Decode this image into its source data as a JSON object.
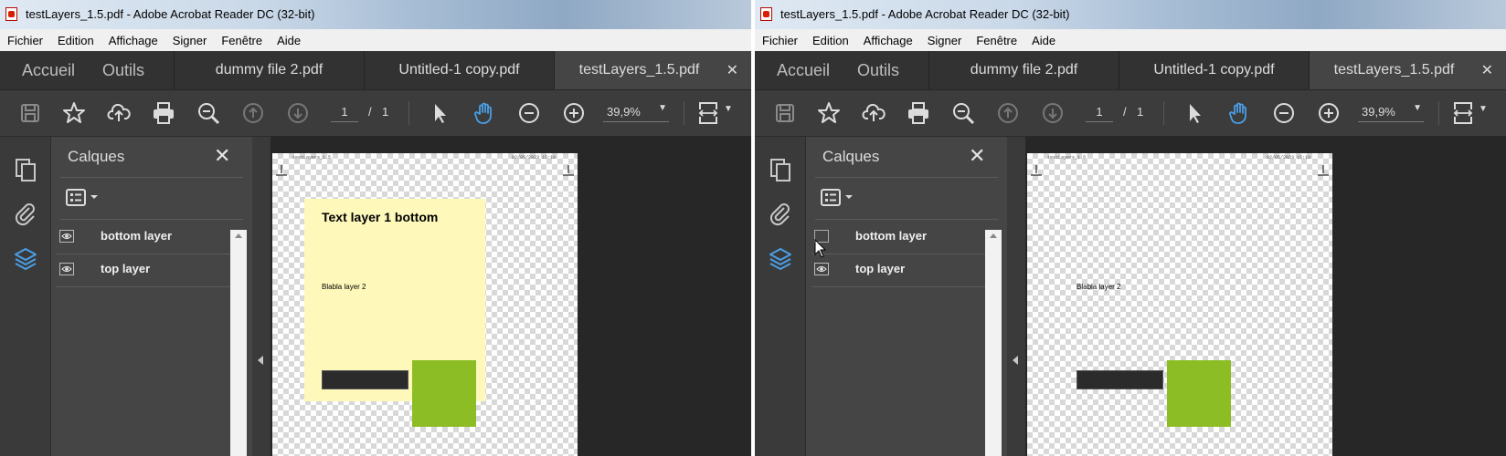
{
  "window": {
    "title": "testLayers_1.5.pdf - Adobe Acrobat Reader DC (32-bit)"
  },
  "menu": [
    "Fichier",
    "Edition",
    "Affichage",
    "Signer",
    "Fenêtre",
    "Aide"
  ],
  "tabs": {
    "home": "Accueil",
    "tools": "Outils",
    "documents": [
      "dummy file 2.pdf",
      "Untitled-1 copy.pdf",
      "testLayers_1.5.pdf"
    ],
    "close": "✕"
  },
  "toolbar": {
    "page_current": "1",
    "page_separator": "/",
    "page_total": "1",
    "zoom": "39,9%"
  },
  "layers_panel": {
    "title": "Calques",
    "close": "✕",
    "layers": [
      "bottom layer",
      "top layer"
    ]
  },
  "document": {
    "header_left": "testLayers_1.5",
    "header_right": "02/05/2023 15:19",
    "text_layer_title": "Text layer 1 bottom",
    "text_layer_body": "Blabla layer 2"
  },
  "states": {
    "left": {
      "bottom_layer_visible": true,
      "top_layer_visible": true
    },
    "right": {
      "bottom_layer_visible": false,
      "top_layer_visible": true
    }
  },
  "colors": {
    "accent": "#4a9fe8",
    "text_layer_bg": "#fef8bb",
    "shape_green": "#8cbd25"
  },
  "icons": [
    "save-icon",
    "star-icon",
    "cloud-upload-icon",
    "print-icon",
    "zoom-search-icon",
    "arrow-up-icon",
    "arrow-down-icon",
    "cursor-icon",
    "hand-icon",
    "zoom-out-icon",
    "zoom-in-icon",
    "fit-page-icon",
    "pages-icon",
    "paperclip-icon",
    "layers-icon",
    "eye-icon",
    "options-icon"
  ]
}
